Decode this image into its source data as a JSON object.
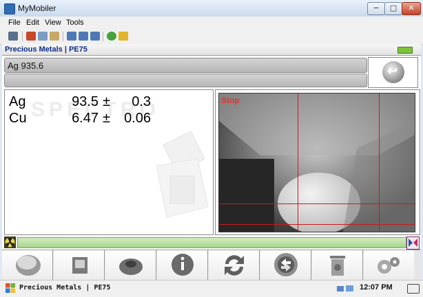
{
  "window": {
    "title": "MyMobiler",
    "min_glyph": "−",
    "max_glyph": "□",
    "close_glyph": "✕"
  },
  "menu": [
    {
      "label": "File"
    },
    {
      "label": "Edit"
    },
    {
      "label": "View"
    },
    {
      "label": "Tools"
    }
  ],
  "toolbar_icons": [
    "device-icon",
    "cut-icon",
    "copy-icon",
    "paste-icon",
    "window-icon",
    "window-add-icon",
    "window-remove-icon",
    "refresh-icon",
    "clean-icon"
  ],
  "device": {
    "header_title": "Precious Metals | PE75",
    "sample_name": "Ag 935.6",
    "watermark": "SPECTRO",
    "results": [
      {
        "element": "Ag",
        "value": "93.5",
        "pm": "±",
        "error": "0.3"
      },
      {
        "element": "Cu",
        "value": "6.47",
        "pm": "±",
        "error": "0.06"
      }
    ],
    "video_status": "Stop",
    "accent_red": "#c81b1b",
    "progress_color": "#a5d48a",
    "buttons": [
      "start-button-icon",
      "sample-chamber-icon",
      "lid-icon",
      "info-icon",
      "refresh-icon",
      "recalibrate-icon",
      "delete-icon",
      "settings-icon"
    ]
  },
  "taskbar": {
    "title": "Precious Metals | PE75",
    "time": "12:07 PM"
  }
}
